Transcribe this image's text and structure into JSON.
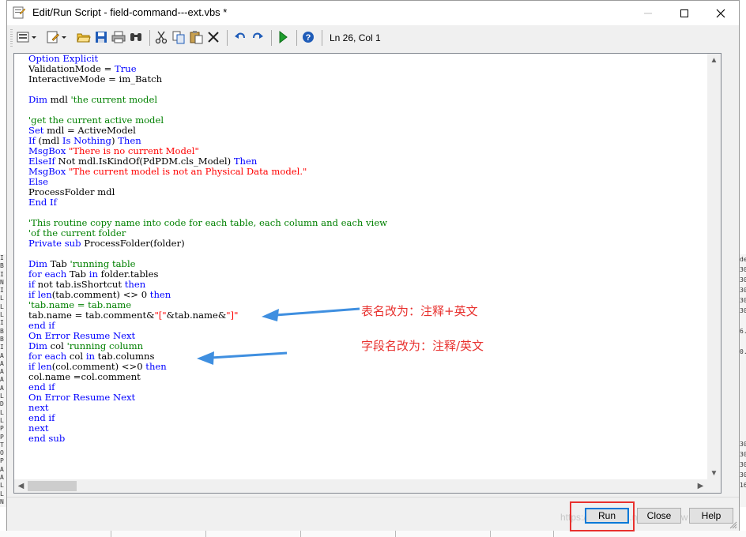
{
  "window": {
    "title": "Edit/Run Script - field-command---ext.vbs *",
    "controls": {
      "minimize": "minimize-icon",
      "maximize": "maximize-icon",
      "close": "close-icon"
    }
  },
  "toolbar": {
    "status": "Ln 26, Col 1",
    "icons": [
      "menu-dropdown-icon",
      "edit-dropdown-icon",
      "open-folder-icon",
      "save-icon",
      "print-icon",
      "find-icon",
      "cut-icon",
      "copy-icon",
      "paste-icon",
      "delete-icon",
      "undo-icon",
      "redo-icon",
      "run-icon",
      "help-icon"
    ]
  },
  "editor": {
    "lines": [
      [
        {
          "t": "Option Explicit",
          "c": "kw"
        }
      ],
      [
        {
          "t": "ValidationMode = "
        },
        {
          "t": "True",
          "c": "kw"
        }
      ],
      [
        {
          "t": "InteractiveMode = im_Batch"
        }
      ],
      [],
      [
        {
          "t": "Dim",
          "c": "kw"
        },
        {
          "t": " mdl "
        },
        {
          "t": "'the current model",
          "c": "cm"
        }
      ],
      [],
      [
        {
          "t": "'get the current active model",
          "c": "cm"
        }
      ],
      [
        {
          "t": "Set",
          "c": "kw"
        },
        {
          "t": " mdl = ActiveModel"
        }
      ],
      [
        {
          "t": "If",
          "c": "kw"
        },
        {
          "t": " (mdl "
        },
        {
          "t": "Is",
          "c": "kw"
        },
        {
          "t": " "
        },
        {
          "t": "Nothing",
          "c": "kw"
        },
        {
          "t": ") "
        },
        {
          "t": "Then",
          "c": "kw"
        }
      ],
      [
        {
          "t": "MsgBox",
          "c": "kw"
        },
        {
          "t": " "
        },
        {
          "t": "\"There is no current Model\"",
          "c": "st"
        }
      ],
      [
        {
          "t": "ElseIf",
          "c": "kw"
        },
        {
          "t": " Not mdl.IsKindOf(PdPDM.cls_Model) "
        },
        {
          "t": "Then",
          "c": "kw"
        }
      ],
      [
        {
          "t": "MsgBox",
          "c": "kw"
        },
        {
          "t": " "
        },
        {
          "t": "\"The current model is not an Physical Data model.\"",
          "c": "st"
        }
      ],
      [
        {
          "t": "Else",
          "c": "kw"
        }
      ],
      [
        {
          "t": "ProcessFolder mdl"
        }
      ],
      [
        {
          "t": "End If",
          "c": "kw"
        }
      ],
      [],
      [
        {
          "t": "'This routine copy name into code for each table, each column and each view",
          "c": "cm"
        }
      ],
      [
        {
          "t": "'of the current folder",
          "c": "cm"
        }
      ],
      [
        {
          "t": "Private",
          "c": "kw"
        },
        {
          "t": " "
        },
        {
          "t": "sub",
          "c": "kw"
        },
        {
          "t": " ProcessFolder(folder)"
        }
      ],
      [],
      [
        {
          "t": "Dim",
          "c": "kw"
        },
        {
          "t": " Tab "
        },
        {
          "t": "'running table",
          "c": "cm"
        }
      ],
      [
        {
          "t": "for",
          "c": "kw"
        },
        {
          "t": " "
        },
        {
          "t": "each",
          "c": "kw"
        },
        {
          "t": " Tab "
        },
        {
          "t": "in",
          "c": "kw"
        },
        {
          "t": " folder.tables"
        }
      ],
      [
        {
          "t": "if",
          "c": "kw"
        },
        {
          "t": " not tab.isShortcut "
        },
        {
          "t": "then",
          "c": "kw"
        }
      ],
      [
        {
          "t": "if",
          "c": "kw"
        },
        {
          "t": " "
        },
        {
          "t": "len",
          "c": "kw"
        },
        {
          "t": "(tab.comment) <> 0 "
        },
        {
          "t": "then",
          "c": "kw"
        }
      ],
      [
        {
          "t": "'tab.name = tab.name",
          "c": "cm"
        }
      ],
      [
        {
          "t": "tab.name = tab.comment&"
        },
        {
          "t": "\"[\"",
          "c": "st"
        },
        {
          "t": "&tab.name&"
        },
        {
          "t": "\"]\"",
          "c": "st"
        }
      ],
      [
        {
          "t": "end if",
          "c": "kw"
        }
      ],
      [
        {
          "t": "On Error Resume Next",
          "c": "kw"
        }
      ],
      [
        {
          "t": "Dim",
          "c": "kw"
        },
        {
          "t": " col "
        },
        {
          "t": "'running column",
          "c": "cm"
        }
      ],
      [
        {
          "t": "for",
          "c": "kw"
        },
        {
          "t": " "
        },
        {
          "t": "each",
          "c": "kw"
        },
        {
          "t": " col "
        },
        {
          "t": "in",
          "c": "kw"
        },
        {
          "t": " tab.columns"
        }
      ],
      [
        {
          "t": "if",
          "c": "kw"
        },
        {
          "t": " "
        },
        {
          "t": "len",
          "c": "kw"
        },
        {
          "t": "(col.comment) <>0 "
        },
        {
          "t": "then",
          "c": "kw"
        }
      ],
      [
        {
          "t": "col.name =col.comment"
        }
      ],
      [
        {
          "t": "end if",
          "c": "kw"
        }
      ],
      [
        {
          "t": "On Error Resume Next",
          "c": "kw"
        }
      ],
      [
        {
          "t": "next",
          "c": "kw"
        }
      ],
      [
        {
          "t": "end if",
          "c": "kw"
        }
      ],
      [
        {
          "t": "next",
          "c": "kw"
        }
      ],
      [
        {
          "t": "end sub",
          "c": "kw"
        }
      ]
    ]
  },
  "annotations": {
    "table_note": "表名改为：注释+英文",
    "column_note": "字段名改为：注释/英文"
  },
  "buttons": {
    "run": "Run",
    "close": "Close",
    "help": "Help"
  },
  "watermark": "https://blog.csdn.net/tonyshow",
  "background": {
    "left_strip": "I\nB\nI\nN\nI\nL\nL\nL\nI\nB\nB\nI\nA\nA\nA\nA\nA\nL\nD\nL\nL\nP\nP\nT\nO\nP\nA\nA\nL\nL\nN",
    "right_strip": "de\n30\n30\n30\n30\n30\n\n6.\n\n0.\n\n\n\n\n\n\n\n\n30\n30\n30\n30\n16"
  },
  "colors": {
    "keyword": "#0000ff",
    "comment": "#008000",
    "string": "#ff0000",
    "annotation": "#e8312e",
    "run_highlight": "#e8312e"
  }
}
